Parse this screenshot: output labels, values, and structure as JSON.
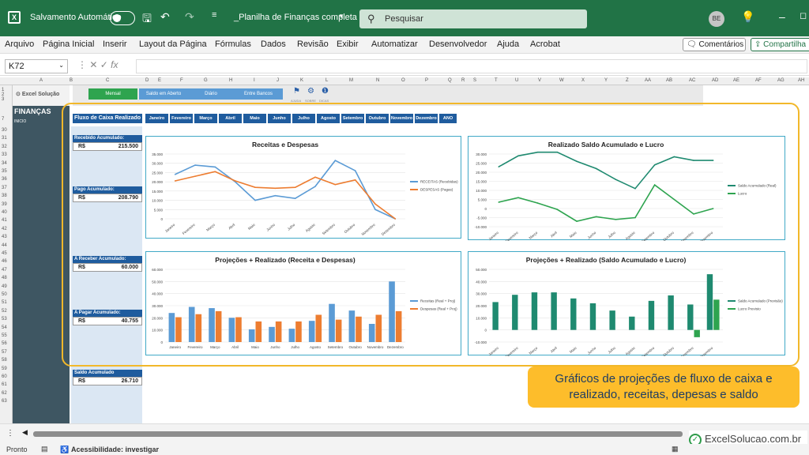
{
  "titlebar": {
    "autosave_label": "Salvamento Automático",
    "doc_title": "_Planilha de Finanças completa",
    "search_placeholder": "Pesquisar",
    "avatar": "BE"
  },
  "menu": [
    "Arquivo",
    "Página Inicial",
    "Inserir",
    "Layout da Página",
    "Fórmulas",
    "Dados",
    "Revisão",
    "Exibir",
    "Automatizar",
    "Desenvolvedor",
    "Ajuda",
    "Acrobat"
  ],
  "comments_button": "Comentários",
  "share_button": "Compartilha",
  "namebox": "K72",
  "columns": [
    "A",
    "B",
    "C",
    "D",
    "E",
    "F",
    "G",
    "H",
    "I",
    "J",
    "K",
    "L",
    "M",
    "N",
    "O",
    "P",
    "Q",
    "R",
    "S",
    "T",
    "U",
    "V",
    "W",
    "X",
    "Y",
    "Z",
    "AA",
    "AB",
    "AC",
    "AD",
    "AE",
    "AF",
    "AG",
    "AH"
  ],
  "rows": [
    "1",
    "2",
    "3",
    "7",
    "30",
    "31",
    "32",
    "33",
    "34",
    "35",
    "36",
    "37",
    "38",
    "39",
    "40",
    "41",
    "42",
    "43",
    "44",
    "45",
    "46",
    "47",
    "48",
    "49",
    "50",
    "51",
    "52",
    "53",
    "54",
    "55",
    "56",
    "57",
    "58",
    "59",
    "60",
    "61",
    "62",
    "63"
  ],
  "sidebar": {
    "logo": "Excel Solução",
    "section": "FINANÇAS",
    "item": "INICIO"
  },
  "toolbar": {
    "buttons": [
      {
        "label": "Mensal",
        "color": "#2ea44f"
      },
      {
        "label": "Saldo em Aberto",
        "color": "#5b9bd5"
      },
      {
        "label": "Diário",
        "color": "#5b9bd5"
      },
      {
        "label": "Entre Bancos",
        "color": "#5b9bd5"
      }
    ],
    "icons": [
      "AJUDA",
      "SOBRE",
      "DICAS"
    ]
  },
  "flow_header": "Fluxo de Caixa Realizado",
  "months": [
    "Janeiro",
    "Fevereiro",
    "Março",
    "Abril",
    "Maio",
    "Junho",
    "Julho",
    "Agosto",
    "Setembro",
    "Outubro",
    "Novembro",
    "Dezembro",
    "ANO"
  ],
  "kpis": [
    {
      "label": "Recebido Acumulado:",
      "currency": "R$",
      "value": "215.500"
    },
    {
      "label": "Pago Acumulado:",
      "currency": "R$",
      "value": "208.790"
    },
    {
      "label": "A Receber Acumulado:",
      "currency": "R$",
      "value": "60.000"
    },
    {
      "label": "A Pagar Acumulado:",
      "currency": "R$",
      "value": "40.755"
    },
    {
      "label": "Saldo Acumulado",
      "currency": "R$",
      "value": "26.710"
    }
  ],
  "callout": "Gráficos de projeções de fluxo  de caixa e realizado, receitas, depesas e saldo",
  "brand": "ExcelSolucao.com.br",
  "status": {
    "ready": "Pronto",
    "accessibility": "Acessibilidade: investigar"
  },
  "chart_data": [
    {
      "type": "line",
      "title": "Receitas e Despesas",
      "categories": [
        "Janeiro",
        "Fevereiro",
        "Março",
        "Abril",
        "Maio",
        "Junho",
        "Julho",
        "Agosto",
        "Setembro",
        "Outubro",
        "Novembro",
        "Dezembro"
      ],
      "ylim": [
        0,
        35000
      ],
      "yticks": [
        "0",
        "5.000",
        "10.000",
        "15.000",
        "20.000",
        "25.000",
        "30.000",
        "35.000"
      ],
      "series": [
        {
          "name": "RECEITAS (Recebidas)",
          "color": "#5b9bd5",
          "values": [
            24000,
            29000,
            28000,
            20000,
            10000,
            12500,
            11000,
            17500,
            31500,
            26000,
            5000,
            0
          ]
        },
        {
          "name": "DESPESAS (Pagas)",
          "color": "#ed7d31",
          "values": [
            20500,
            23000,
            25500,
            20500,
            17000,
            16500,
            17000,
            22500,
            18500,
            21000,
            8000,
            0
          ]
        }
      ]
    },
    {
      "type": "line",
      "title": "Realizado Saldo Acumulado e Lucro",
      "categories": [
        "Janeiro",
        "Fevereiro",
        "Março",
        "Abril",
        "Maio",
        "Junho",
        "Julho",
        "Agosto",
        "Setembro",
        "Outubro",
        "Novembro",
        "Dezembro"
      ],
      "ylim": [
        -10000,
        30000
      ],
      "yticks": [
        "-10.000",
        "-5.000",
        "0",
        "5.000",
        "10.000",
        "15.000",
        "20.000",
        "25.000",
        "30.000"
      ],
      "series": [
        {
          "name": "Saldo Acumulado (Real)",
          "color": "#1f8a70",
          "values": [
            23000,
            29000,
            31000,
            31000,
            26000,
            22000,
            16000,
            11000,
            24000,
            28500,
            26500,
            26500
          ]
        },
        {
          "name": "Lucro",
          "color": "#2ea44f",
          "values": [
            3500,
            6000,
            3000,
            -500,
            -7000,
            -4500,
            -6000,
            -5000,
            13000,
            5000,
            -3000,
            0
          ]
        }
      ]
    },
    {
      "type": "bar",
      "title": "Projeções + Realizado (Receita e Despesas)",
      "categories": [
        "Janeiro",
        "Fevereiro",
        "Março",
        "Abril",
        "Maio",
        "Junho",
        "Julho",
        "Agosto",
        "Setembro",
        "Outubro",
        "Novembro",
        "Dezembro"
      ],
      "ylim": [
        0,
        60000
      ],
      "yticks": [
        "0",
        "10.000",
        "20.000",
        "30.000",
        "40.000",
        "50.000",
        "60.000"
      ],
      "series": [
        {
          "name": "Receitas (Real + Proj)",
          "color": "#5b9bd5",
          "values": [
            24000,
            29000,
            28000,
            20000,
            10500,
            12500,
            11000,
            17500,
            31500,
            26000,
            15000,
            50000
          ]
        },
        {
          "name": "Despesas (Real + Proj)",
          "color": "#ed7d31",
          "values": [
            20500,
            23000,
            25500,
            20500,
            17000,
            17000,
            17000,
            22500,
            18500,
            21000,
            22500,
            25500
          ]
        }
      ]
    },
    {
      "type": "bar",
      "title": "Projeções + Realizado (Saldo Acumulado e Lucro)",
      "categories": [
        "Janeiro",
        "Fevereiro",
        "Março",
        "Abril",
        "Maio",
        "Junho",
        "Julho",
        "Agosto",
        "Setembro",
        "Outubro",
        "Novembro",
        "Dezembro"
      ],
      "ylim": [
        -10000,
        50000
      ],
      "yticks": [
        "-10.000",
        "0",
        "10.000",
        "20.000",
        "30.000",
        "40.000",
        "50.000"
      ],
      "series": [
        {
          "name": "Saldo Acumulado (Previsão)",
          "color": "#1f8a70",
          "values": [
            23000,
            29000,
            31000,
            31000,
            26000,
            22000,
            16000,
            11000,
            24000,
            28500,
            21000,
            46000
          ]
        },
        {
          "name": "Lucro Previsto",
          "color": "#2ea44f",
          "values": [
            0,
            0,
            0,
            0,
            0,
            0,
            0,
            0,
            0,
            0,
            -6000,
            25000
          ]
        }
      ]
    }
  ]
}
